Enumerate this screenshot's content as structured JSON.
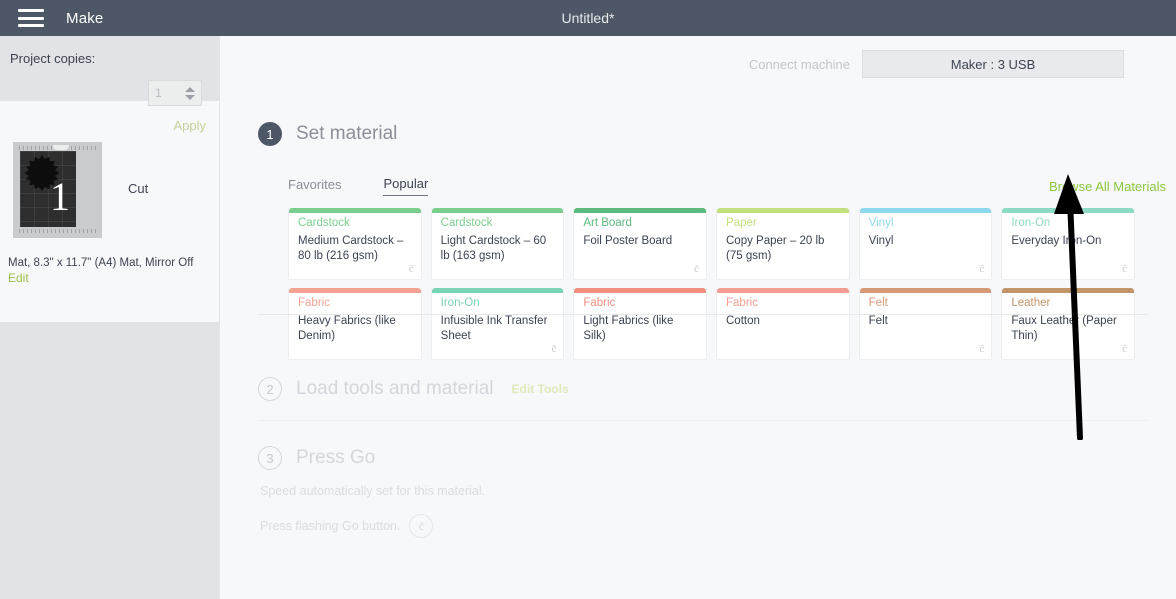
{
  "topbar": {
    "menu_icon": "hamburger-icon",
    "app_title": "Make",
    "document_title": "Untitled*"
  },
  "sidebar": {
    "copies_label": "Project copies:",
    "copies_value": "1",
    "copies_placeholder": "1",
    "apply_label": "Apply",
    "mat": {
      "number": "1",
      "operation_label": "Cut",
      "description": "Mat, 8.3\" x 11.7\" (A4) Mat, Mirror Off",
      "edit_label": "Edit"
    }
  },
  "machine_bar": {
    "connect_label": "Connect machine",
    "selected_machine": "Maker : 3 USB"
  },
  "steps": {
    "step1": {
      "number": "1",
      "title": "Set material",
      "state": "active"
    },
    "step2": {
      "number": "2",
      "title": "Load tools and material",
      "state": "inactive",
      "edit_tools_label": "Edit Tools"
    },
    "step3": {
      "number": "3",
      "title": "Press Go",
      "state": "inactive",
      "speed_note": "Speed automatically set for this material.",
      "press_go_text": "Press flashing Go button.",
      "go_icon": "cricut-logo-icon"
    }
  },
  "material_picker": {
    "tabs": [
      {
        "label": "Favorites",
        "selected": false
      },
      {
        "label": "Popular",
        "selected": true
      }
    ],
    "browse_all_label": "Browse All Materials",
    "browse_all_color": "#8cc63f",
    "cards": [
      {
        "category": "Cardstock",
        "name": "Medium Cardstock – 80 lb (216 gsm)",
        "color": "#7bcf8e",
        "logo": true
      },
      {
        "category": "Cardstock",
        "name": "Light Cardstock – 60 lb (163 gsm)",
        "color": "#7bcf8e",
        "logo": false
      },
      {
        "category": "Art Board",
        "name": "Foil Poster Board",
        "color": "#5cb97f",
        "logo": true
      },
      {
        "category": "Paper",
        "name": "Copy Paper – 20 lb (75 gsm)",
        "color": "#c3e07f",
        "logo": false
      },
      {
        "category": "Vinyl",
        "name": "Vinyl",
        "color": "#8fd9ef",
        "logo": true
      },
      {
        "category": "Iron-On",
        "name": "Everyday Iron-On",
        "color": "#8ddbc4",
        "logo": true
      },
      {
        "category": "Fabric",
        "name": "Heavy Fabrics (like Denim)",
        "color": "#f5a392",
        "logo": false
      },
      {
        "category": "Iron-On",
        "name": "Infusible Ink Transfer Sheet",
        "color": "#79d3b4",
        "logo": true
      },
      {
        "category": "Fabric",
        "name": "Light Fabrics (like Silk)",
        "color": "#f08e80",
        "logo": false
      },
      {
        "category": "Fabric",
        "name": "Cotton",
        "color": "#f49d92",
        "logo": false
      },
      {
        "category": "Felt",
        "name": "Felt",
        "color": "#d79a78",
        "logo": true
      },
      {
        "category": "Leather",
        "name": "Faux Leather (Paper Thin)",
        "color": "#c19568",
        "logo": true
      }
    ],
    "card_logo_glyph": "č"
  },
  "annotation": {
    "type": "arrow",
    "color": "#000000",
    "points_to": "Browse All Materials"
  }
}
